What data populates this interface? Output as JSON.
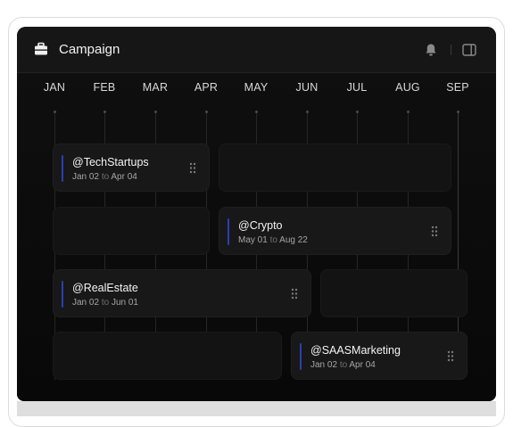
{
  "header": {
    "title": "Campaign"
  },
  "months": [
    "JAN",
    "FEB",
    "MAR",
    "APR",
    "MAY",
    "JUN",
    "JUL",
    "AUG",
    "SEP"
  ],
  "campaigns": [
    {
      "handle": "@TechStartups",
      "start": "Jan 02",
      "sep": "to",
      "end": "Apr 04"
    },
    {
      "handle": "@Crypto",
      "start": "May 01",
      "sep": "to",
      "end": "Aug 22"
    },
    {
      "handle": "@RealEstate",
      "start": "Jan 02",
      "sep": "to",
      "end": "Jun 01"
    },
    {
      "handle": "@SAASMarketing",
      "start": "Jan 02",
      "sep": "to",
      "end": "Apr 04"
    }
  ],
  "colors": {
    "accent_bar": "#2c3fb0",
    "background": "#0c0c0c"
  }
}
